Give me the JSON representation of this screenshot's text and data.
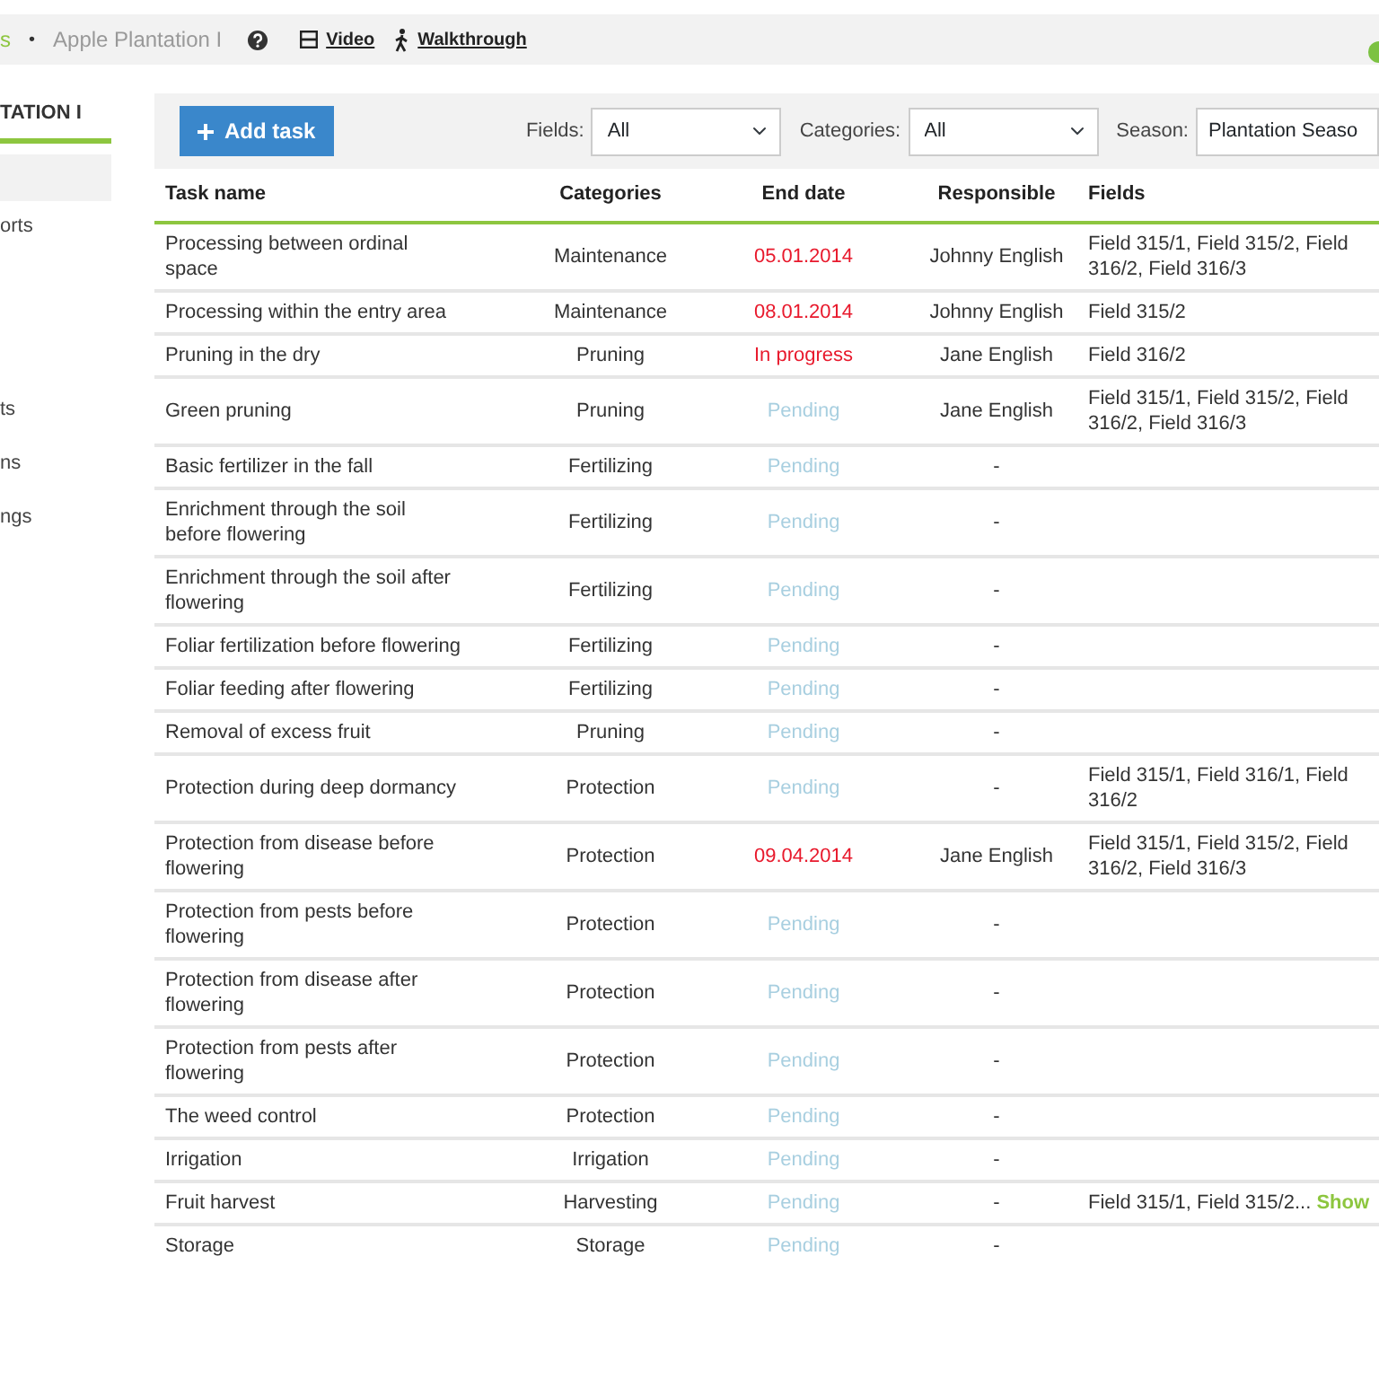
{
  "topbar": {
    "breadcrumb": [
      {
        "text": "s",
        "kind": "link"
      },
      {
        "text": "•",
        "kind": "separator"
      },
      {
        "text": "Apple Plantation I",
        "kind": "current"
      }
    ],
    "links": [
      {
        "text": "Video",
        "kind": "video"
      },
      {
        "text": "Walkthrough",
        "kind": "walk"
      }
    ]
  },
  "sidebar": {
    "title": "TATION I",
    "items": [
      {
        "selected": true
      },
      {
        "text": "orts",
        "selected": false
      },
      {
        "text": "ts",
        "selected": false
      },
      {
        "text": "ns",
        "selected": false
      },
      {
        "text": "ngs",
        "selected": false
      }
    ]
  },
  "toolbar": {
    "add_button": "Add task",
    "filters": [
      {
        "label": "Fields:",
        "value": "All",
        "kind": "select"
      },
      {
        "label": "Categories:",
        "value": "All",
        "kind": "select"
      },
      {
        "label": "Season:",
        "value": "Plantation Seaso",
        "kind": "input"
      }
    ]
  },
  "table": {
    "columns": [
      "Task name",
      "Categories",
      "End date",
      "Responsible",
      "Fields"
    ],
    "rows": [
      {
        "task": "Processing between ordinal space",
        "category": "Maintenance",
        "end_date": "05.01.2014",
        "kind": "late",
        "responsible": "Johnny English",
        "fields": "Field 315/1, Field 315/2, Field 316/2, Field 316/3"
      },
      {
        "task": "Processing within the entry area",
        "category": "Maintenance",
        "end_date": "08.01.2014",
        "kind": "late",
        "responsible": "Johnny English",
        "fields": "Field 315/2"
      },
      {
        "task": "Pruning in the dry",
        "category": "Pruning",
        "end_date": "In progress",
        "kind": "late",
        "responsible": "Jane English",
        "fields": "Field 316/2"
      },
      {
        "task": "Green pruning",
        "category": "Pruning",
        "end_date": "Pending",
        "kind": "pending",
        "responsible": "Jane English",
        "fields": "Field 315/1, Field 315/2, Field 316/2, Field 316/3"
      },
      {
        "task": "Basic fertilizer in the fall",
        "category": "Fertilizing",
        "end_date": "Pending",
        "kind": "pending",
        "responsible": "-"
      },
      {
        "task": "Enrichment through the soil before flowering",
        "category": "Fertilizing",
        "end_date": "Pending",
        "kind": "pending",
        "responsible": "-"
      },
      {
        "task": "Enrichment through the soil after flowering",
        "category": "Fertilizing",
        "end_date": "Pending",
        "kind": "pending",
        "responsible": "-"
      },
      {
        "task": "Foliar fertilization before flowering",
        "category": "Fertilizing",
        "end_date": "Pending",
        "kind": "pending",
        "responsible": "-"
      },
      {
        "task": "Foliar feeding after flowering",
        "category": "Fertilizing",
        "end_date": "Pending",
        "kind": "pending",
        "responsible": "-"
      },
      {
        "task": "Removal of excess fruit",
        "category": "Pruning",
        "end_date": "Pending",
        "kind": "pending",
        "responsible": "-"
      },
      {
        "task": "Protection during deep dormancy",
        "category": "Protection",
        "end_date": "Pending",
        "kind": "pending",
        "responsible": "-",
        "fields": "Field 315/1, Field 316/1, Field 316/2"
      },
      {
        "task": "Protection from disease before flowering",
        "category": "Protection",
        "end_date": "09.04.2014",
        "kind": "late",
        "responsible": "Jane English",
        "fields": "Field 315/1, Field 315/2, Field 316/2, Field 316/3"
      },
      {
        "task": "Protection from pests before flowering",
        "category": "Protection",
        "end_date": "Pending",
        "kind": "pending",
        "responsible": "-"
      },
      {
        "task": "Protection from disease after flowering",
        "category": "Protection",
        "end_date": "Pending",
        "kind": "pending",
        "responsible": "-"
      },
      {
        "task": "Protection from pests after flowering",
        "category": "Protection",
        "end_date": "Pending",
        "kind": "pending",
        "responsible": "-"
      },
      {
        "task": "The weed control",
        "category": "Protection",
        "end_date": "Pending",
        "kind": "pending",
        "responsible": "-"
      },
      {
        "task": "Irrigation",
        "category": "Irrigation",
        "end_date": "Pending",
        "kind": "pending",
        "responsible": "-"
      },
      {
        "task": "Fruit harvest",
        "category": "Harvesting",
        "end_date": "Pending",
        "kind": "pending",
        "responsible": "-",
        "fields": "Field 315/1, Field 315/2...",
        "more_link": "Show"
      },
      {
        "task": "Storage",
        "category": "Storage",
        "end_date": "Pending",
        "kind": "pending",
        "responsible": "-"
      }
    ]
  }
}
